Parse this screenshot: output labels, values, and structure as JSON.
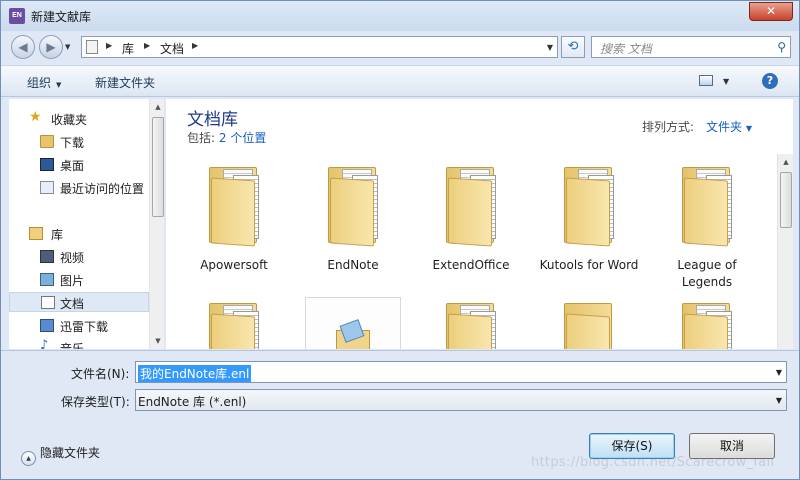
{
  "window": {
    "title": "新建文献库",
    "app_icon_text": "EN",
    "close_glyph": "✕"
  },
  "nav": {
    "back_glyph": "◀",
    "forward_glyph": "▶",
    "breadcrumb": [
      "库",
      "文档"
    ],
    "refresh_glyph": "⟲",
    "search_placeholder": "搜索 文档"
  },
  "toolbar": {
    "organize_label": "组织",
    "new_folder_label": "新建文件夹",
    "help_glyph": "?"
  },
  "sidebar": {
    "favorites": {
      "label": "收藏夹",
      "items": [
        "下载",
        "桌面",
        "最近访问的位置"
      ]
    },
    "libraries": {
      "label": "库",
      "items": [
        "视频",
        "图片",
        "文档",
        "迅雷下载",
        "音乐"
      ]
    },
    "selected": "文档"
  },
  "content": {
    "title": "文档库",
    "includes_prefix": "包括:",
    "includes_link": "2 个位置",
    "arrange_label": "排列方式:",
    "arrange_value": "文件夹",
    "folders_row1": [
      "Apowersoft",
      "EndNote",
      "ExtendOffice",
      "Kutools for Word",
      "League of Legends"
    ]
  },
  "form": {
    "filename_label": "文件名(N):",
    "filename_value": "我的EndNote库.enl",
    "filetype_label": "保存类型(T):",
    "filetype_value": "EndNote 库 (*.enl)"
  },
  "footer": {
    "hide_folders_label": "隐藏文件夹",
    "save_label": "保存(S)",
    "cancel_label": "取消",
    "watermark": "https://blog.csdn.net/Scarecrow_fail"
  },
  "colors": {
    "accent": "#1660c8",
    "title_blue": "#1e3a8a",
    "selection": "#3399ff",
    "window_frame": "#dfe8f4"
  }
}
